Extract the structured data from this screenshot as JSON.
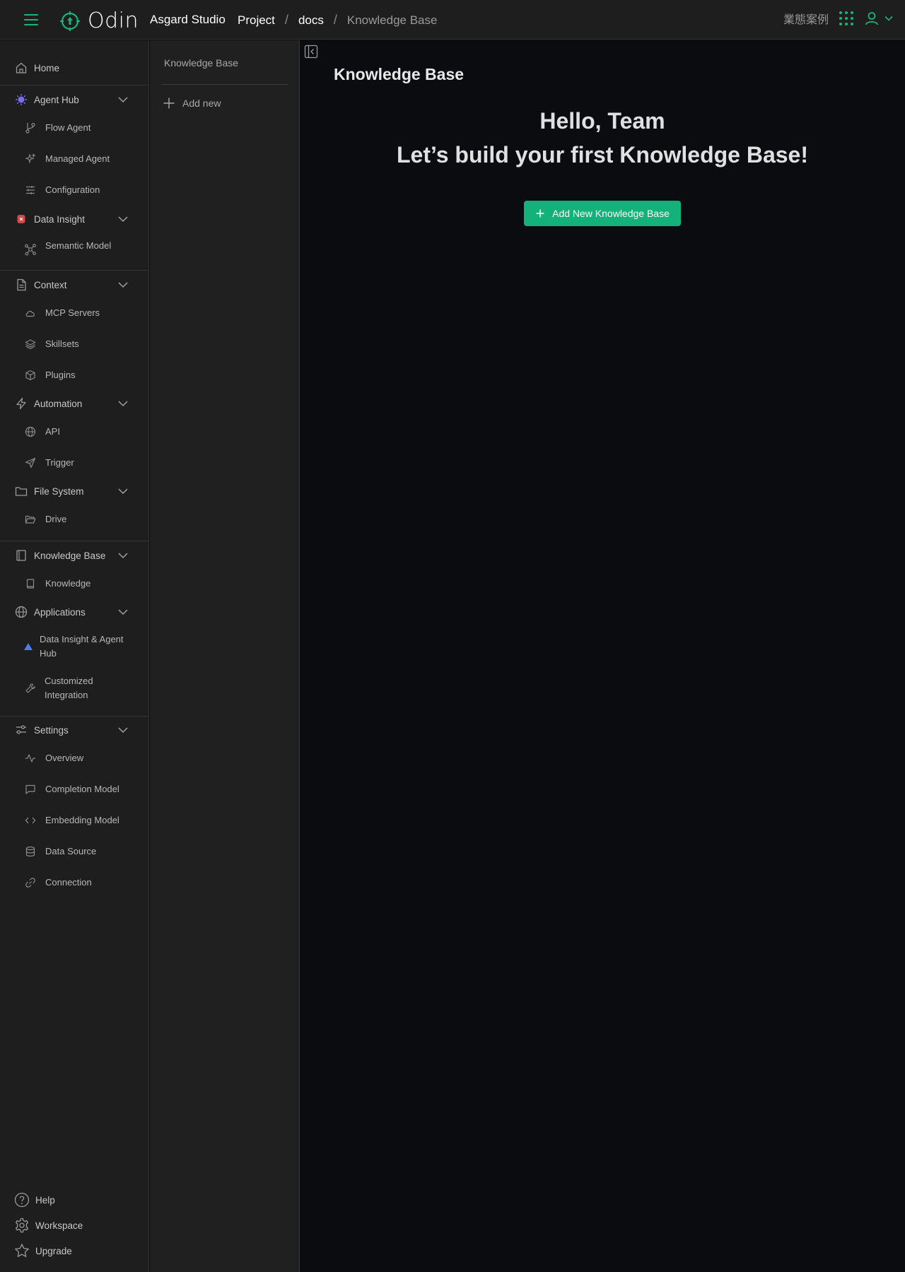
{
  "header": {
    "logo_text": "Odin",
    "studio": "Asgard Studio",
    "breadcrumbs": [
      "Project",
      "docs",
      "Knowledge Base"
    ],
    "lang_label": "業態案例"
  },
  "sidebar": {
    "home": "Home",
    "agent_hub": "Agent Hub",
    "flow_agent": "Flow Agent",
    "managed_agent": "Managed Agent",
    "configuration": "Configuration",
    "data_insight": "Data Insight",
    "semantic_model": "Semantic Model",
    "context": "Context",
    "mcp_servers": "MCP Servers",
    "skillsets": "Skillsets",
    "plugins": "Plugins",
    "automation": "Automation",
    "api": "API",
    "trigger": "Trigger",
    "file_system": "File System",
    "drive": "Drive",
    "knowledge_base": "Knowledge Base",
    "knowledge": "Knowledge",
    "applications": "Applications",
    "data_insight_agent_hub_1": "Data Insight & Agent",
    "data_insight_agent_hub_2": "Hub",
    "customized_integration_1": "Customized",
    "customized_integration_2": "Integration",
    "settings": "Settings",
    "overview": "Overview",
    "completion_model": "Completion Model",
    "embedding_model": "Embedding Model",
    "data_source": "Data Source",
    "connection": "Connection",
    "help": "Help",
    "workspace": "Workspace",
    "upgrade": "Upgrade"
  },
  "panel": {
    "title": "Knowledge Base",
    "add_new": "Add new"
  },
  "main": {
    "title": "Knowledge Base",
    "greeting": "Hello, Team",
    "subtitle": "Let’s build your first Knowledge Base!",
    "cta_label": "Add New Knowledge Base"
  },
  "colors": {
    "accent": "#18b47b",
    "background": "#0b0c10",
    "sidebar": "#1e1e1e"
  }
}
